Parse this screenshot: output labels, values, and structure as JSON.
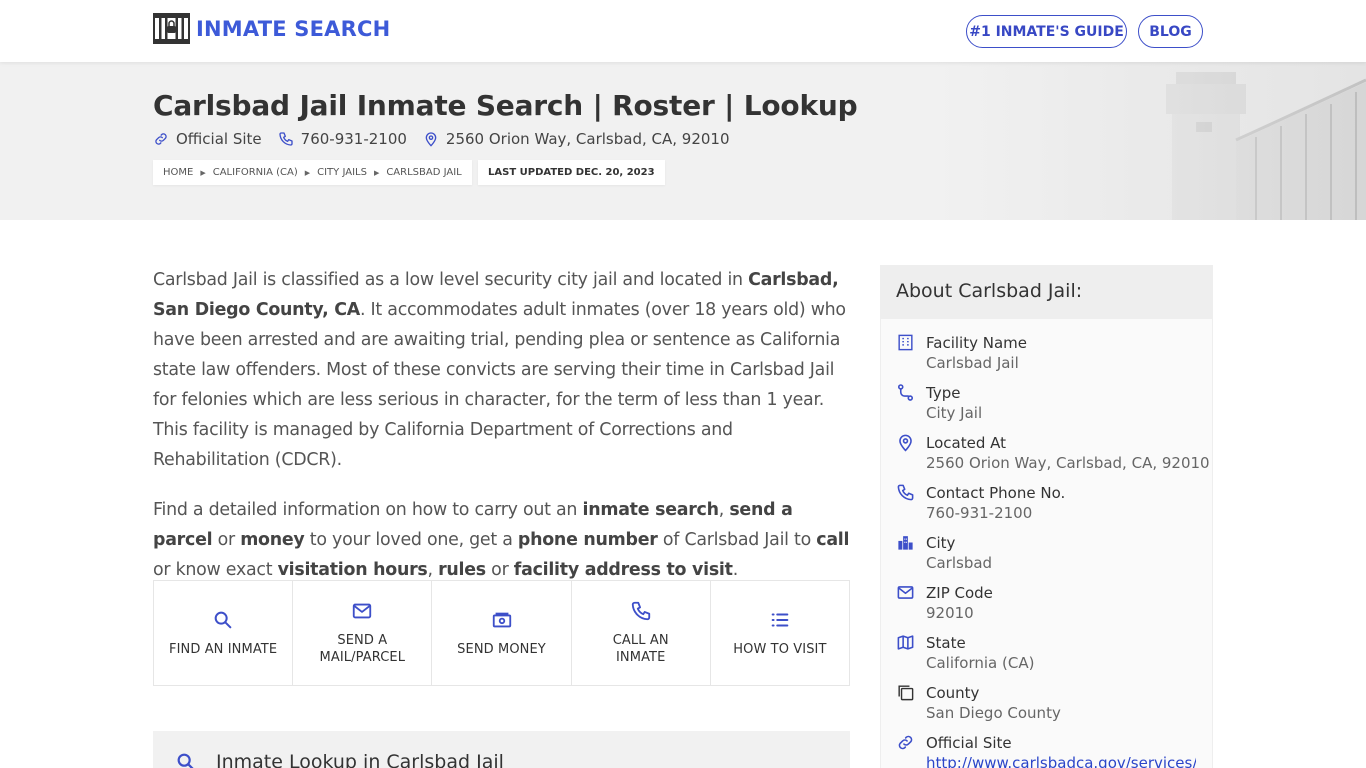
{
  "header": {
    "logo_text": "INMATE SEARCH",
    "nav": {
      "guide_label": "#1 INMATE'S GUIDE",
      "blog_label": "BLOG"
    },
    "accent_color": "#3d5ad8"
  },
  "hero": {
    "title": "Carlsbad Jail Inmate Search | Roster | Lookup",
    "meta": {
      "official_site": "Official Site",
      "phone": "760-931-2100",
      "address": "2560 Orion Way, Carlsbad, CA, 92010"
    },
    "breadcrumb": [
      "HOME",
      "CALIFORNIA (CA)",
      "CITY JAILS",
      "CARLSBAD JAIL"
    ],
    "updated": "LAST UPDATED DEC. 20, 2023"
  },
  "intro": {
    "p1": [
      {
        "t": "Carlsbad Jail is classified as a low level security city jail and located in ",
        "b": false
      },
      {
        "t": "Carlsbad, San Diego County, CA",
        "b": true
      },
      {
        "t": ". It accommodates adult inmates (over 18 years old) who have been arrested and are awaiting trial, pending plea or sentence as California state law offenders. Most of these convicts are serving their time in Carlsbad Jail for felonies which are less serious in character, for the term of less than 1 year. This facility is managed by California Department of Corrections and Rehabilitation (CDCR).",
        "b": false
      }
    ],
    "p2": [
      {
        "t": "Find a detailed information on how to carry out an ",
        "b": false
      },
      {
        "t": "inmate search",
        "b": true
      },
      {
        "t": ", ",
        "b": false
      },
      {
        "t": "send a parcel",
        "b": true
      },
      {
        "t": " or ",
        "b": false
      },
      {
        "t": "money",
        "b": true
      },
      {
        "t": " to your loved one, get a ",
        "b": false
      },
      {
        "t": "phone number",
        "b": true
      },
      {
        "t": " of Carlsbad Jail to ",
        "b": false
      },
      {
        "t": "call",
        "b": true
      },
      {
        "t": " or know exact ",
        "b": false
      },
      {
        "t": "visitation hours",
        "b": true
      },
      {
        "t": ", ",
        "b": false
      },
      {
        "t": "rules",
        "b": true
      },
      {
        "t": " or ",
        "b": false
      },
      {
        "t": "facility address to visit",
        "b": true
      },
      {
        "t": ".",
        "b": false
      }
    ]
  },
  "actions": [
    {
      "line1": "FIND AN INMATE",
      "line2": "",
      "icon": "search-icon"
    },
    {
      "line1": "SEND A",
      "line2": "MAIL/PARCEL",
      "icon": "mail-icon"
    },
    {
      "line1": "SEND MONEY",
      "line2": "",
      "icon": "money-icon"
    },
    {
      "line1": "CALL AN",
      "line2": "INMATE",
      "icon": "phone-icon"
    },
    {
      "line1": "HOW TO VISIT",
      "line2": "",
      "icon": "list-icon"
    }
  ],
  "lookup": {
    "title": "Inmate Lookup in Carlsbad Jail"
  },
  "sidebar": {
    "title": "About Carlsbad Jail:",
    "facts": [
      {
        "label": "Facility Name",
        "value": "Carlsbad Jail",
        "icon": "building-icon"
      },
      {
        "label": "Type",
        "value": "City Jail",
        "icon": "route-icon"
      },
      {
        "label": "Located At",
        "value": "2560 Orion Way, Carlsbad, CA, 92010",
        "icon": "location-pin-icon"
      },
      {
        "label": "Contact Phone No.",
        "value": "760-931-2100",
        "icon": "phone-icon"
      },
      {
        "label": "City",
        "value": "Carlsbad",
        "icon": "city-icon"
      },
      {
        "label": "ZIP Code",
        "value": "92010",
        "icon": "envelope-icon"
      },
      {
        "label": "State",
        "value": "California (CA)",
        "icon": "map-icon"
      },
      {
        "label": "County",
        "value": "San Diego County",
        "icon": "copy-icon"
      },
      {
        "label": "Official Site",
        "value": "http://www.carlsbadca.gov/services/dep",
        "icon": "link-icon"
      }
    ]
  }
}
